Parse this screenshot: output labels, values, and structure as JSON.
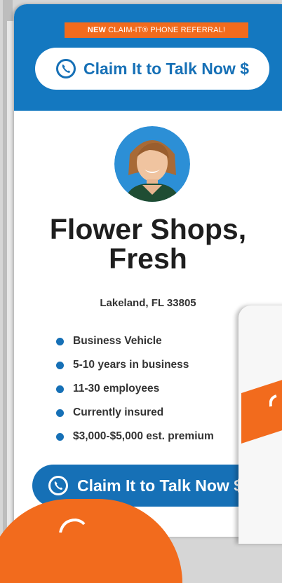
{
  "header": {
    "promo_new": "NEW",
    "promo_rest": "CLAIM-IT® PHONE REFERRAL!",
    "claim_label": "Claim It to Talk Now $"
  },
  "business": {
    "title": "Flower Shops, Fresh",
    "location": "Lakeland, FL 33805"
  },
  "features": [
    "Business Vehicle",
    "5-10 years in business",
    "11-30 employees",
    "Currently insured",
    "$3,000-$5,000 est. premium"
  ],
  "footer": {
    "claim_label": "Claim It to Talk Now $"
  },
  "icons": {
    "phone": "phone-icon",
    "avatar": "person-avatar"
  },
  "colors": {
    "brand_blue": "#1670b6",
    "header_blue": "#1478c0",
    "accent_orange": "#f26b1d"
  }
}
